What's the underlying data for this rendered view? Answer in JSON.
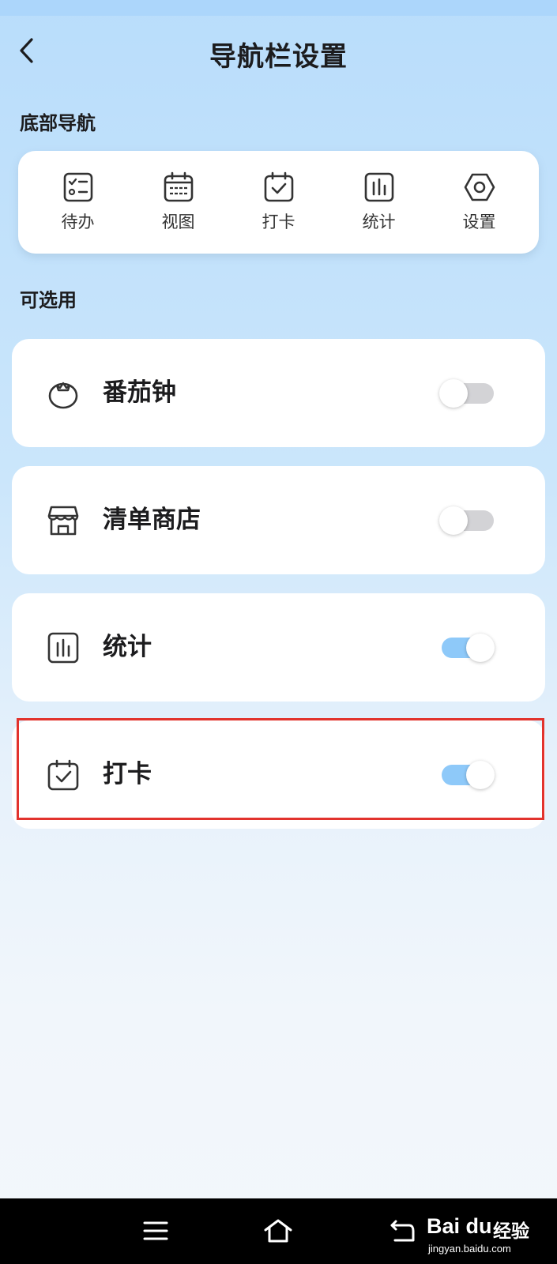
{
  "header": {
    "title": "导航栏设置"
  },
  "bottom_nav_section": {
    "title": "底部导航",
    "items": [
      {
        "label": "待办",
        "icon": "todo-list-icon"
      },
      {
        "label": "视图",
        "icon": "calendar-view-icon"
      },
      {
        "label": "打卡",
        "icon": "calendar-check-icon"
      },
      {
        "label": "统计",
        "icon": "bar-chart-icon"
      },
      {
        "label": "设置",
        "icon": "hex-nut-settings-icon"
      }
    ]
  },
  "optional_section": {
    "title": "可选用",
    "items": [
      {
        "label": "番茄钟",
        "icon": "tomato-icon",
        "enabled": false
      },
      {
        "label": "清单商店",
        "icon": "store-icon",
        "enabled": false
      },
      {
        "label": "统计",
        "icon": "bar-chart-icon",
        "enabled": true
      },
      {
        "label": "打卡",
        "icon": "calendar-check-icon",
        "enabled": true
      }
    ]
  },
  "system_nav": {
    "buttons": [
      "menu-icon",
      "home-icon",
      "back-icon"
    ]
  },
  "watermark": {
    "brand": "Bai du",
    "cn": "经验",
    "url": "jingyan.baidu.com"
  },
  "colors": {
    "toggle_on": "#8ec9f9",
    "toggle_off": "#d3d3d6",
    "highlight": "#e2332d",
    "background_top": "#b9ddfb"
  }
}
